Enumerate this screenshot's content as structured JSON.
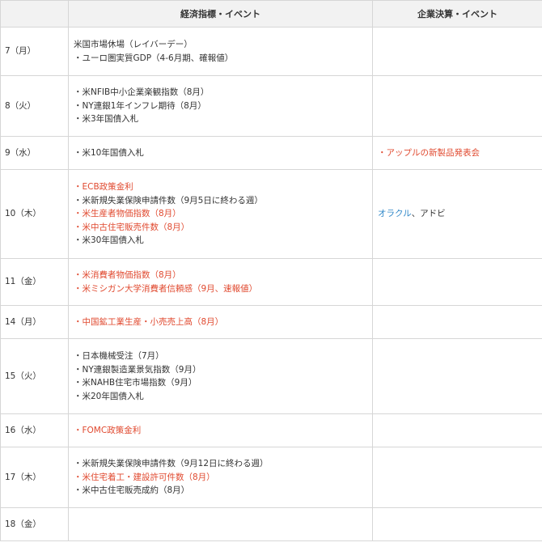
{
  "colors": {
    "highlight_red": "#e0492f",
    "link_blue": "#2f87c8",
    "header_bg": "#f2f2f2",
    "border": "#d6d6d6"
  },
  "header": {
    "date": "",
    "econ": "経済指標・イベント",
    "corp": "企業決算・イベント"
  },
  "rows": [
    {
      "date": "7（月）",
      "econ": [
        {
          "text": "米国市場休場（レイバーデー）",
          "red": false
        },
        {
          "text": "・ユーロ圏実質GDP（4-6月期、確報値）",
          "red": false
        }
      ],
      "corp": []
    },
    {
      "date": "8（火）",
      "econ": [
        {
          "text": "・米NFIB中小企業楽観指数（8月）",
          "red": false
        },
        {
          "text": "・NY連銀1年インフレ期待（8月）",
          "red": false
        },
        {
          "text": "・米3年国債入札",
          "red": false
        }
      ],
      "corp": []
    },
    {
      "date": "9（水）",
      "econ": [
        {
          "text": "・米10年国債入札",
          "red": false
        }
      ],
      "corp": [
        {
          "text": "・アップルの新製品発表会",
          "style": "red"
        }
      ]
    },
    {
      "date": "10（木）",
      "econ": [
        {
          "text": "・ECB政策金利",
          "red": true
        },
        {
          "text": "・米新規失業保険申請件数（9月5日に終わる週）",
          "red": false
        },
        {
          "text": "・米生産者物価指数（8月）",
          "red": true
        },
        {
          "text": "・米中古住宅販売件数（8月）",
          "red": true
        },
        {
          "text": "・米30年国債入札",
          "red": false
        }
      ],
      "corp": [
        {
          "text": "オラクル",
          "style": "blue"
        },
        {
          "text": "、アドビ",
          "style": "normal"
        }
      ]
    },
    {
      "date": "11（金）",
      "econ": [
        {
          "text": "・米消費者物価指数（8月）",
          "red": true
        },
        {
          "text": "・米ミシガン大学消費者信頼感（9月、速報値）",
          "red": true
        }
      ],
      "corp": []
    },
    {
      "date": "14（月）",
      "econ": [
        {
          "text": "・中国鉱工業生産・小売売上高（8月）",
          "red": true
        }
      ],
      "corp": []
    },
    {
      "date": "15（火）",
      "econ": [
        {
          "text": "・日本機械受注（7月）",
          "red": false
        },
        {
          "text": "・NY連銀製造業景気指数（9月）",
          "red": false
        },
        {
          "text": "・米NAHB住宅市場指数（9月）",
          "red": false
        },
        {
          "text": "・米20年国債入札",
          "red": false
        }
      ],
      "corp": []
    },
    {
      "date": "16（水）",
      "econ": [
        {
          "text": "・FOMC政策金利",
          "red": true
        }
      ],
      "corp": []
    },
    {
      "date": "17（木）",
      "econ": [
        {
          "text": "・米新規失業保険申請件数（9月12日に終わる週）",
          "red": false
        },
        {
          "text": "・米住宅着工・建設許可件数（8月）",
          "red": true
        },
        {
          "text": "・米中古住宅販売成約（8月）",
          "red": false
        }
      ],
      "corp": []
    },
    {
      "date": "18（金）",
      "econ": [],
      "corp": []
    }
  ]
}
